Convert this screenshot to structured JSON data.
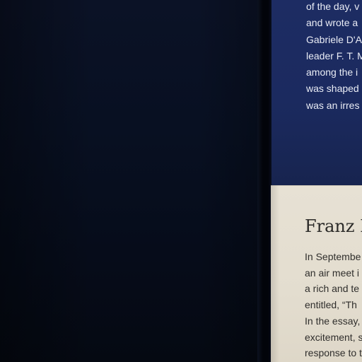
{
  "navy_panel": {
    "lines": [
      "of the day, v",
      "and wrote a",
      "Gabriele D'A",
      "leader F. T. M",
      "among the i",
      "was shaped",
      "was an irres"
    ]
  },
  "label_panel": {
    "title": "Franz K",
    "lines": [
      "In Septembe",
      "an air meet i",
      "a rich and te",
      "entitled, “Th",
      "In the essay,",
      "excitement, s",
      "response to t"
    ]
  },
  "colors": {
    "wall": "#081022",
    "navy_panel": "#1b2a5f",
    "cream_panel": "#e5dfd2",
    "navy_text": "#e9ecf5",
    "cream_text": "#2f2e2c"
  }
}
